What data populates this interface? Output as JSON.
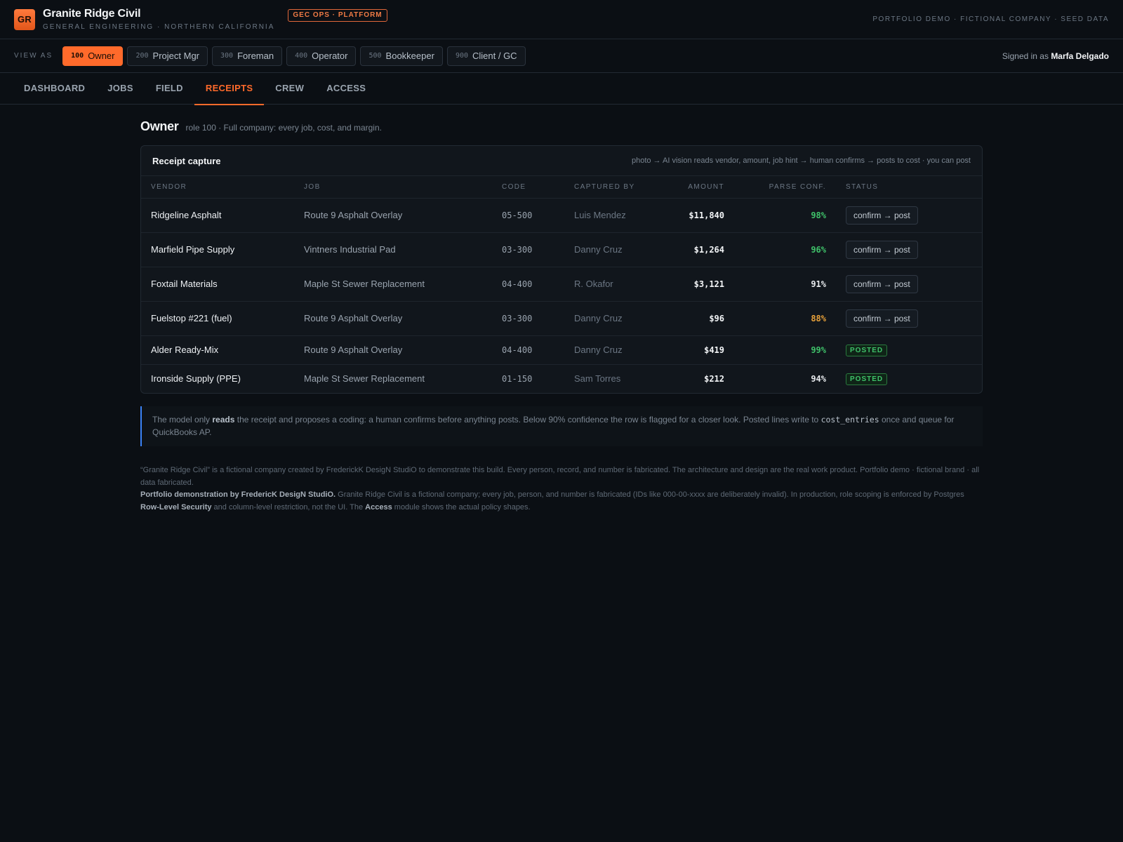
{
  "brand": {
    "logo": "GR",
    "title": "Granite Ridge Civil",
    "subtitle": "GENERAL ENGINEERING · NORTHERN CALIFORNIA",
    "badge": "GEC OPS · PLATFORM",
    "top_right": "PORTFOLIO DEMO · FICTIONAL COMPANY · SEED DATA"
  },
  "view_as": {
    "label": "VIEW AS",
    "roles": [
      {
        "code": "100",
        "label": "Owner",
        "active": true
      },
      {
        "code": "200",
        "label": "Project Mgr"
      },
      {
        "code": "300",
        "label": "Foreman"
      },
      {
        "code": "400",
        "label": "Operator"
      },
      {
        "code": "500",
        "label": "Bookkeeper"
      },
      {
        "code": "900",
        "label": "Client / GC"
      }
    ],
    "signed_in_prefix": "Signed in as",
    "signed_in_user": "Marfa Delgado"
  },
  "nav": {
    "tabs": [
      "DASHBOARD",
      "JOBS",
      "FIELD",
      "RECEIPTS",
      "CREW",
      "ACCESS"
    ],
    "active": "RECEIPTS"
  },
  "role_header": {
    "title": "Owner",
    "subtitle": "role 100 · Full company: every job, cost, and margin."
  },
  "receipts": {
    "title": "Receipt capture",
    "note": "photo → AI vision reads vendor, amount, job hint → human confirms → posts to cost · you can post",
    "columns": [
      "VENDOR",
      "JOB",
      "CODE",
      "CAPTURED BY",
      "AMOUNT",
      "PARSE CONF.",
      "STATUS"
    ],
    "rows": [
      {
        "vendor": "Ridgeline Asphalt",
        "job": "Route 9 Asphalt Overlay",
        "code": "05-500",
        "by": "Luis Mendez",
        "amount": "$11,840",
        "conf": "98%",
        "conf_color": "green",
        "status": "confirm → post",
        "posted": false
      },
      {
        "vendor": "Marfield Pipe Supply",
        "job": "Vintners Industrial Pad",
        "code": "03-300",
        "by": "Danny Cruz",
        "amount": "$1,264",
        "conf": "96%",
        "conf_color": "green",
        "status": "confirm → post",
        "posted": false
      },
      {
        "vendor": "Foxtail Materials",
        "job": "Maple St Sewer Replacement",
        "code": "04-400",
        "by": "R. Okafor",
        "amount": "$3,121",
        "conf": "91%",
        "conf_color": "white",
        "status": "confirm → post",
        "posted": false
      },
      {
        "vendor": "Fuelstop #221 (fuel)",
        "job": "Route 9 Asphalt Overlay",
        "code": "03-300",
        "by": "Danny Cruz",
        "amount": "$96",
        "conf": "88%",
        "conf_color": "amber",
        "status": "confirm → post",
        "posted": false
      },
      {
        "vendor": "Alder Ready-Mix",
        "job": "Route 9 Asphalt Overlay",
        "code": "04-400",
        "by": "Danny Cruz",
        "amount": "$419",
        "conf": "99%",
        "conf_color": "green",
        "status": "POSTED",
        "posted": true
      },
      {
        "vendor": "Ironside Supply (PPE)",
        "job": "Maple St Sewer Replacement",
        "code": "01-150",
        "by": "Sam Torres",
        "amount": "$212",
        "conf": "94%",
        "conf_color": "white",
        "status": "POSTED",
        "posted": true
      }
    ]
  },
  "callout": {
    "t1": "The model only ",
    "b1": "reads",
    "t2": " the receipt and proposes a coding: a human confirms before anything posts. Below 90% confidence the row is flagged for a closer look. Posted lines write to ",
    "code": "cost_entries",
    "t3": " once and queue for QuickBooks AP."
  },
  "footer": {
    "line1": "“Granite Ridge Civil” is a fictional company created by FrederickK DesigN StudiO to demonstrate this build. Every person, record, and number is fabricated. The architecture and design are the real work product. Portfolio demo · fictional brand · all data fabricated.",
    "b1": "Portfolio demonstration by FredericK DesigN StudiO.",
    "t2": " Granite Ridge Civil is a fictional company; every job, person, and number is fabricated (IDs like 000-00-xxxx are deliberately invalid). In production, role scoping is enforced by Postgres ",
    "b2": "Row-Level Security",
    "t3": " and column-level restriction, not the UI. The ",
    "b3": "Access",
    "t4": " module shows the actual policy shapes."
  },
  "colors": {
    "accent": "#ff6a2b",
    "background": "#0b0f14",
    "conf_green": "#3fc26a",
    "conf_amber": "#e8a13a",
    "callout_border": "#3b82f6"
  }
}
